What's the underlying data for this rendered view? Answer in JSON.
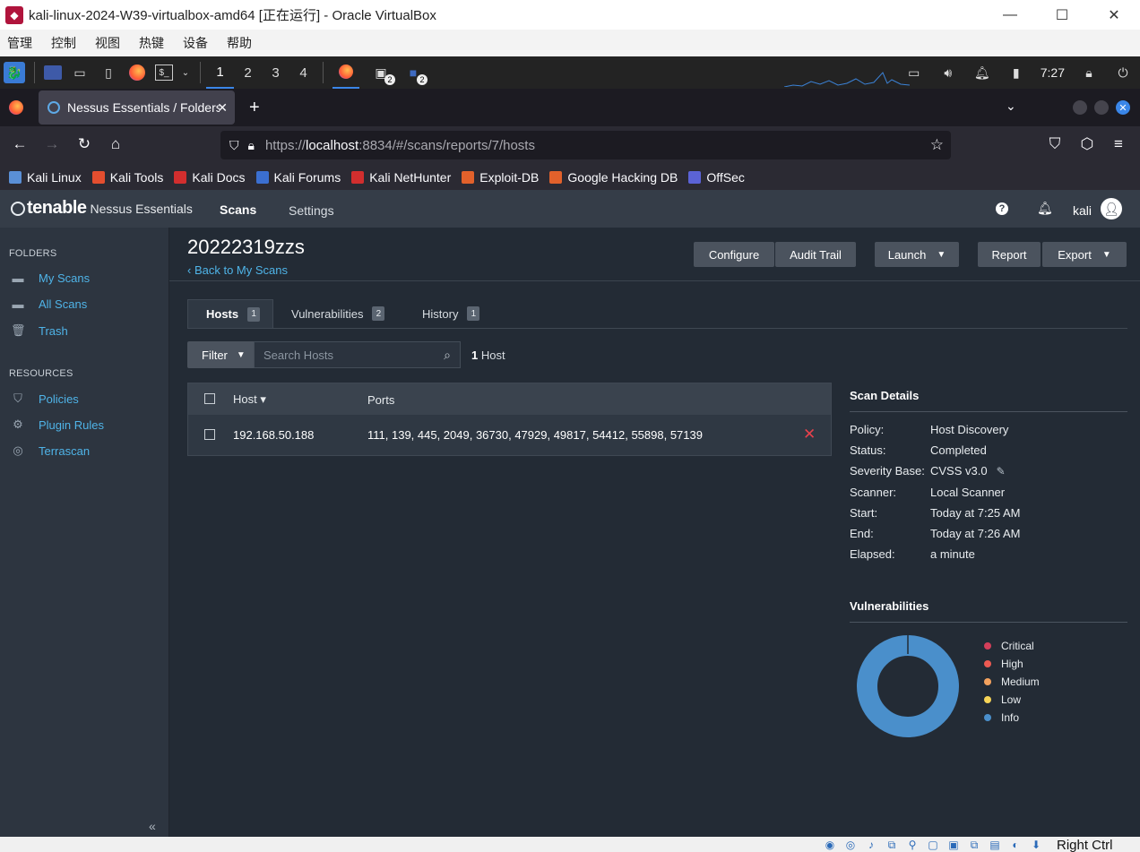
{
  "vbox": {
    "window_title": "kali-linux-2024-W39-virtualbox-amd64 [正在运行] - Oracle VirtualBox",
    "menu": [
      "管理",
      "控制",
      "视图",
      "热键",
      "设备",
      "帮助"
    ],
    "win_controls": [
      "—",
      "☐",
      "✕"
    ],
    "status_host_key": "Right Ctrl"
  },
  "kali_panel": {
    "workspaces": [
      "1",
      "2",
      "3",
      "4"
    ],
    "active_workspace": "1",
    "terminal_badge": "2",
    "files_badge": "2",
    "clock": "7:27"
  },
  "firefox": {
    "tab_title": "Nessus Essentials / Folders / View Scan",
    "tab_close": "✕",
    "new_tab": "+",
    "url_prefix": "https://",
    "url_host": "localhost",
    "url_rest": ":8834/#/scans/reports/7/hosts",
    "bookmarks": [
      {
        "label": "Kali Linux",
        "color": "#5a8fd6"
      },
      {
        "label": "Kali Tools",
        "color": "#e44e2f"
      },
      {
        "label": "Kali Docs",
        "color": "#d22e2e"
      },
      {
        "label": "Kali Forums",
        "color": "#3b6fd1"
      },
      {
        "label": "Kali NetHunter",
        "color": "#d22e2e"
      },
      {
        "label": "Exploit-DB",
        "color": "#e2612b"
      },
      {
        "label": "Google Hacking DB",
        "color": "#e2612b"
      },
      {
        "label": "OffSec",
        "color": "#5b63d6"
      }
    ]
  },
  "nessus": {
    "brand": "tenable",
    "product": "Nessus Essentials",
    "nav": {
      "scans": "Scans",
      "settings": "Settings"
    },
    "help_label": "?",
    "user": "kali",
    "sidebar": {
      "folders_heading": "FOLDERS",
      "folders": [
        {
          "label": "My Scans",
          "icon": "folder-icon"
        },
        {
          "label": "All Scans",
          "icon": "folder-icon"
        },
        {
          "label": "Trash",
          "icon": "trash-icon"
        }
      ],
      "resources_heading": "RESOURCES",
      "resources": [
        {
          "label": "Policies",
          "icon": "shield-icon"
        },
        {
          "label": "Plugin Rules",
          "icon": "plugin-icon"
        },
        {
          "label": "Terrascan",
          "icon": "terrascan-icon"
        }
      ],
      "collapse_label": "«"
    },
    "scan": {
      "title": "20222319zzs",
      "back_link": "‹ Back to My Scans"
    },
    "toolbar": {
      "configure": "Configure",
      "audit_trail": "Audit Trail",
      "launch": "Launch",
      "report": "Report",
      "export": "Export"
    },
    "tabs": [
      {
        "label": "Hosts",
        "count": "1"
      },
      {
        "label": "Vulnerabilities",
        "count": "2"
      },
      {
        "label": "History",
        "count": "1"
      }
    ],
    "filter": {
      "button": "Filter",
      "placeholder": "Search Hosts",
      "count_number": "1",
      "count_label": " Host"
    },
    "table": {
      "headers": {
        "host": "Host ▾",
        "ports": "Ports"
      },
      "rows": [
        {
          "host": "192.168.50.188",
          "ports": "111, 139, 445, 2049, 36730, 47929, 49817, 54412, 55898, 57139"
        }
      ]
    },
    "scan_details": {
      "title": "Scan Details",
      "rows": [
        {
          "key": "Policy:",
          "value": "Host Discovery"
        },
        {
          "key": "Status:",
          "value": "Completed"
        },
        {
          "key": "Severity Base:",
          "value": "CVSS v3.0"
        },
        {
          "key": "Scanner:",
          "value": "Local Scanner"
        },
        {
          "key": "Start:",
          "value": "Today at 7:25 AM"
        },
        {
          "key": "End:",
          "value": "Today at 7:26 AM"
        },
        {
          "key": "Elapsed:",
          "value": "a minute"
        }
      ]
    },
    "vulnerabilities": {
      "title": "Vulnerabilities",
      "legend": [
        {
          "label": "Critical",
          "color": "#d43f5a"
        },
        {
          "label": "High",
          "color": "#ee5a52"
        },
        {
          "label": "Medium",
          "color": "#f4a25e"
        },
        {
          "label": "Low",
          "color": "#f7d557"
        },
        {
          "label": "Info",
          "color": "#4a8fcb"
        }
      ],
      "donut_color": "#4a8fcb"
    }
  }
}
